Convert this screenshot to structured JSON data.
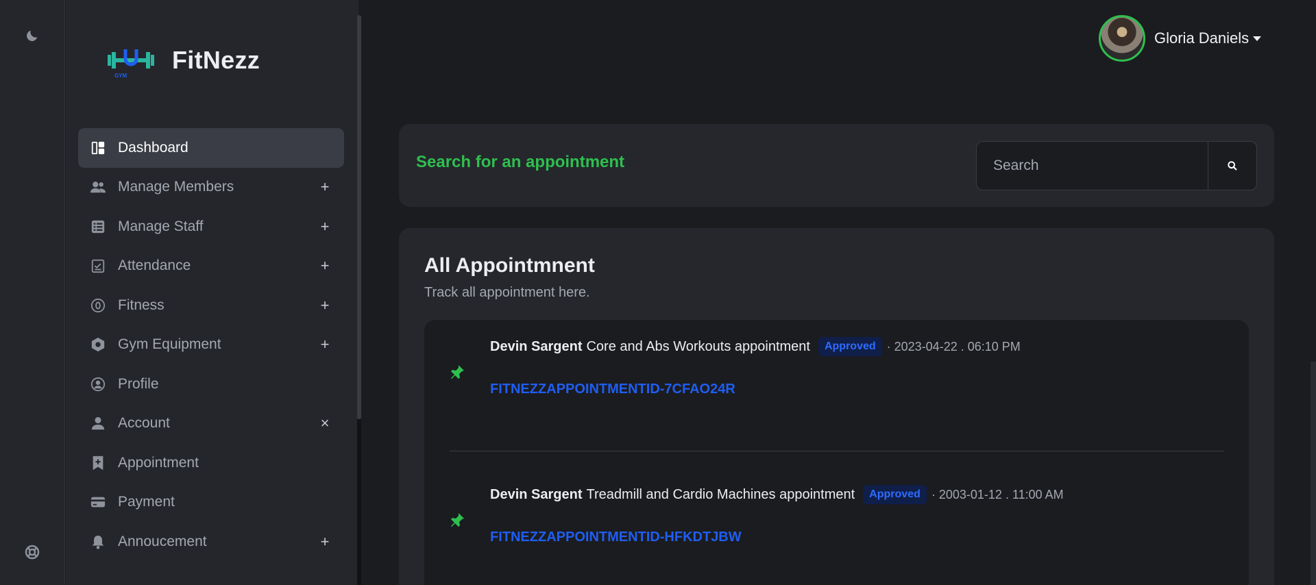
{
  "rail": {
    "theme_icon": "moon-icon",
    "help_icon": "lifebuoy-icon"
  },
  "brand": {
    "name": "FitNezz",
    "logo_icon": "dumbbell-logo-icon"
  },
  "sidebar": {
    "items": [
      {
        "label": "Dashboard",
        "icon": "dashboard-icon",
        "expander": "",
        "active": true
      },
      {
        "label": "Manage Members",
        "icon": "members-icon",
        "expander": "+"
      },
      {
        "label": "Manage Staff",
        "icon": "staff-icon",
        "expander": "+"
      },
      {
        "label": "Attendance",
        "icon": "attendance-icon",
        "expander": "+"
      },
      {
        "label": "Fitness",
        "icon": "fitness-icon",
        "expander": "+"
      },
      {
        "label": "Gym Equipment",
        "icon": "equipment-icon",
        "expander": "+"
      },
      {
        "label": "Profile",
        "icon": "profile-icon",
        "expander": ""
      },
      {
        "label": "Account",
        "icon": "account-icon",
        "expander": "×"
      },
      {
        "label": "Appointment",
        "icon": "appointment-icon",
        "expander": ""
      },
      {
        "label": "Payment",
        "icon": "payment-icon",
        "expander": ""
      },
      {
        "label": "Annoucement",
        "icon": "bell-icon",
        "expander": "+"
      }
    ]
  },
  "header": {
    "user_name": "Gloria Daniels"
  },
  "search": {
    "title": "Search for an appointment",
    "placeholder": "Search"
  },
  "appointments": {
    "title": "All Appointmnent",
    "subtitle": "Track all appointment here.",
    "items": [
      {
        "name": "Devin Sargent",
        "description": "Core and Abs Workouts appointment",
        "status": "Approved",
        "date": "· 2023-04-22 . 06:10 PM",
        "id": "FITNEZZAPPOINTMENTID-7CFAO24R"
      },
      {
        "name": "Devin Sargent",
        "description": "Treadmill and Cardio Machines appointment",
        "status": "Approved",
        "date": "· 2003-01-12 . 11:00 AM",
        "id": "FITNEZZAPPOINTMENTID-HFKDTJBW"
      }
    ]
  },
  "colors": {
    "accent_green": "#2fbf4e",
    "link_blue": "#1f5ef2",
    "badge_bg": "#0f1f4a",
    "background": "#1b1c20",
    "card": "#25272c"
  }
}
